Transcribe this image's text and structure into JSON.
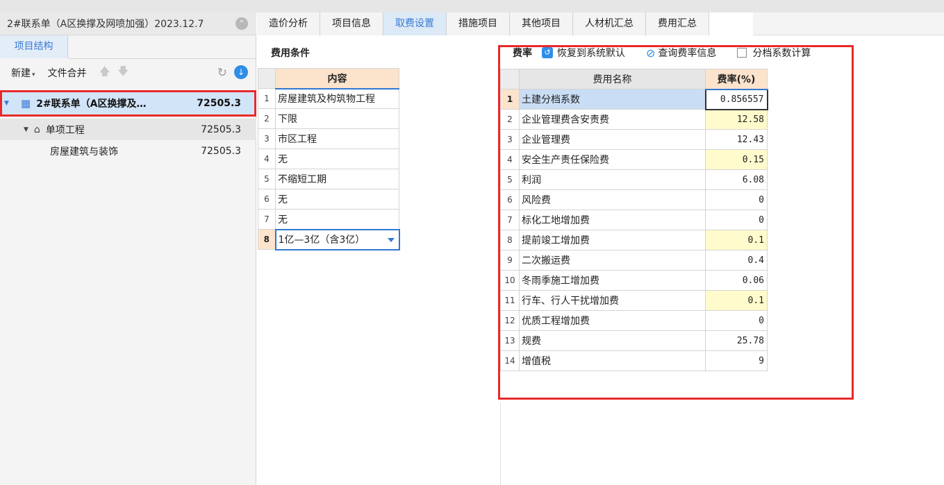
{
  "project": {
    "title": "2#联系单（A区换撑及网喷加强）2023.12.7",
    "structure_tab": "项目结构",
    "toolbar": {
      "new_label": "新建",
      "merge_label": "文件合并"
    },
    "tree": {
      "root": {
        "name": "2#联系单（A区换撑及…",
        "value": "72505.3"
      },
      "sub": {
        "name": "单项工程",
        "value": "72505.3"
      },
      "leaf": {
        "name": "房屋建筑与装饰",
        "value": "72505.3"
      }
    }
  },
  "tabs": [
    "造价分析",
    "项目信息",
    "取费设置",
    "措施项目",
    "其他项目",
    "人材机汇总",
    "费用汇总"
  ],
  "active_tab": "取费设置",
  "conditions": {
    "title": "费用条件",
    "header": "内容",
    "rows": [
      {
        "no": "1",
        "value": "房屋建筑及构筑物工程"
      },
      {
        "no": "2",
        "value": "下限"
      },
      {
        "no": "3",
        "value": "市区工程"
      },
      {
        "no": "4",
        "value": "无"
      },
      {
        "no": "5",
        "value": "不缩短工期"
      },
      {
        "no": "6",
        "value": "无"
      },
      {
        "no": "7",
        "value": "无"
      },
      {
        "no": "8",
        "value": "1亿—3亿（含3亿）"
      }
    ]
  },
  "rates": {
    "title": "费率",
    "restore_label": "恢复到系统默认",
    "query_label": "查询费率信息",
    "tier_label": "分档系数计算",
    "col_name": "费用名称",
    "col_rate": "费率(%)",
    "rows": [
      {
        "no": "1",
        "name": "土建分档系数",
        "rate": "0.856557"
      },
      {
        "no": "2",
        "name": "企业管理费含安责费",
        "rate": "12.58"
      },
      {
        "no": "3",
        "name": "企业管理费",
        "rate": "12.43"
      },
      {
        "no": "4",
        "name": "安全生产责任保险费",
        "rate": "0.15"
      },
      {
        "no": "5",
        "name": "利润",
        "rate": "6.08"
      },
      {
        "no": "6",
        "name": "风险费",
        "rate": "0"
      },
      {
        "no": "7",
        "name": "标化工地增加费",
        "rate": "0"
      },
      {
        "no": "8",
        "name": "提前竣工增加费",
        "rate": "0.1"
      },
      {
        "no": "9",
        "name": "二次搬运费",
        "rate": "0.4"
      },
      {
        "no": "10",
        "name": "冬雨季施工增加费",
        "rate": "0.06"
      },
      {
        "no": "11",
        "name": "行车、行人干扰增加费",
        "rate": "0.1"
      },
      {
        "no": "12",
        "name": "优质工程增加费",
        "rate": "0"
      },
      {
        "no": "13",
        "name": "规费",
        "rate": "25.78"
      },
      {
        "no": "14",
        "name": "增值税",
        "rate": "9"
      }
    ]
  }
}
